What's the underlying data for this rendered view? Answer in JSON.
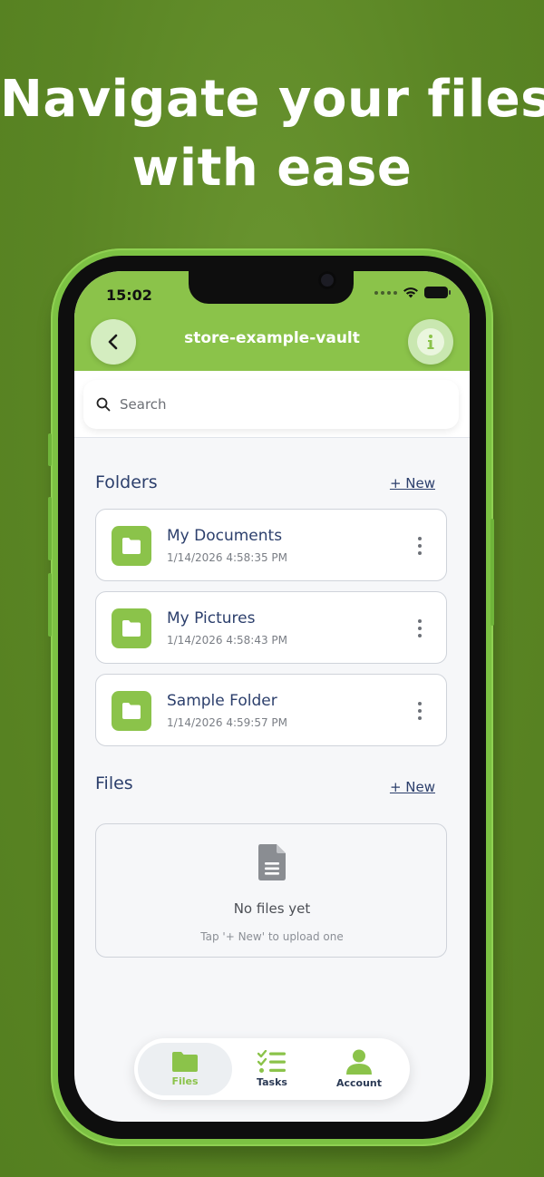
{
  "headline": {
    "line1": "Navigate your files",
    "line2": "with ease"
  },
  "status_bar": {
    "time": "15:02"
  },
  "header": {
    "title": "store-example-vault",
    "back_icon": "chevron-left-icon",
    "info_icon": "info-icon"
  },
  "search": {
    "placeholder": "Search"
  },
  "folders_section": {
    "title": "Folders",
    "new_label": "+ New",
    "items": [
      {
        "name": "My Documents",
        "date": "1/14/2026 4:58:35 PM"
      },
      {
        "name": "My Pictures",
        "date": "1/14/2026 4:58:43 PM"
      },
      {
        "name": "Sample Folder",
        "date": "1/14/2026 4:59:57 PM"
      }
    ]
  },
  "files_section": {
    "title": "Files",
    "new_label": "+ New",
    "empty_title": "No files yet",
    "empty_subtitle": "Tap '+ New' to upload one"
  },
  "tabbar": {
    "tabs": [
      {
        "label": "Files",
        "icon": "folder-icon",
        "active": true
      },
      {
        "label": "Tasks",
        "icon": "checklist-icon",
        "active": false
      },
      {
        "label": "Account",
        "icon": "user-icon",
        "active": false
      }
    ]
  },
  "colors": {
    "background": "#5a8524",
    "accent": "#8bc34a",
    "frame": "#7cc243",
    "text_primary": "#2c3f6c"
  }
}
